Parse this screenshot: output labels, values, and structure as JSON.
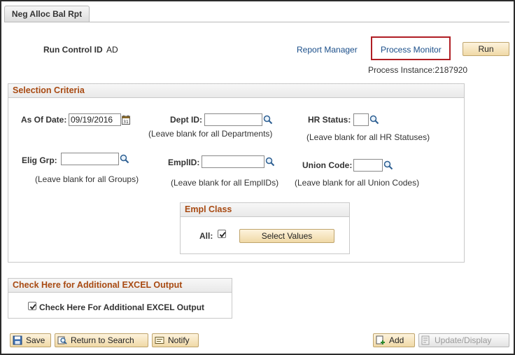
{
  "tab": {
    "label": "Neg Alloc Bal Rpt"
  },
  "header": {
    "run_control_label": "Run Control ID",
    "run_control_value": "AD",
    "report_manager": "Report Manager",
    "process_monitor": "Process Monitor",
    "run_button": "Run",
    "process_instance": "Process Instance:2187920"
  },
  "selection_criteria": {
    "title": "Selection Criteria",
    "as_of_date_label": "As Of Date:",
    "as_of_date_value": "09/19/2016",
    "dept_id_label": "Dept ID:",
    "dept_id_value": "",
    "dept_hint": "(Leave blank for all Departments)",
    "hr_status_label": "HR Status:",
    "hr_status_value": "",
    "hr_hint": "(Leave blank for all HR Statuses)",
    "elig_grp_label": "Elig Grp:",
    "elig_grp_value": "",
    "elig_hint": "(Leave blank for all Groups)",
    "emplid_label": "EmplID:",
    "emplid_value": "",
    "emplid_hint": "(Leave blank for all EmplIDs)",
    "union_code_label": "Union Code:",
    "union_code_value": "",
    "union_hint": "(Leave blank for all Union Codes)",
    "empl_class": {
      "title": "Empl Class",
      "all_label": "All:",
      "all_checked": true,
      "select_values": "Select Values"
    }
  },
  "excel": {
    "title": "Check Here for Additional EXCEL Output",
    "checkbox_label": "Check Here For Additional EXCEL Output",
    "checked": true
  },
  "toolbar": {
    "save": "Save",
    "return_to_search": "Return to Search",
    "notify": "Notify",
    "add": "Add",
    "update_display": "Update/Display"
  },
  "colors": {
    "accent_header": "#a84a12",
    "link": "#1b4f8a",
    "highlight_box": "#b01e24",
    "button_fill": "#f0d9a6"
  }
}
